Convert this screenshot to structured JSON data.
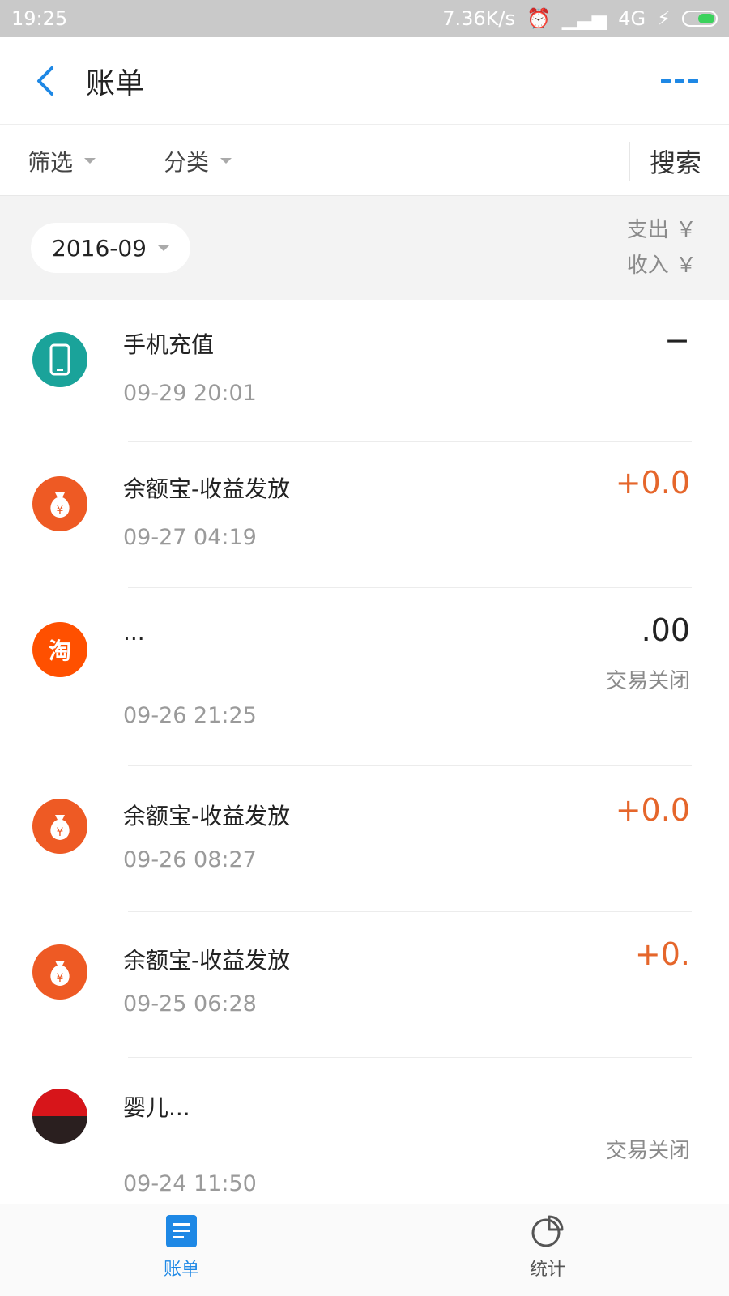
{
  "status_bar": {
    "time": "19:25",
    "network_speed": "7.36K/s",
    "network_type": "4G"
  },
  "header": {
    "title": "账单"
  },
  "filters": {
    "filter_label": "筛选",
    "category_label": "分类",
    "search_label": "搜索"
  },
  "summary": {
    "month": "2016-09",
    "expense": "支出 ￥",
    "income": "收入 ￥"
  },
  "transactions": [
    {
      "icon": "phone-icon",
      "title": "手机充值",
      "time": "09-29  20:01",
      "amount": "−",
      "status": ""
    },
    {
      "icon": "money-bag-icon",
      "title": "余额宝-收益发放",
      "time": "09-27  04:19",
      "amount": "+0.0",
      "status": ""
    },
    {
      "icon": "taobao-icon",
      "title": "...",
      "time": "09-26  21:25",
      "amount": ".00",
      "status": "交易关闭"
    },
    {
      "icon": "money-bag-icon",
      "title": "余额宝-收益发放",
      "time": "09-26  08:27",
      "amount": "+0.0",
      "status": ""
    },
    {
      "icon": "money-bag-icon",
      "title": "余额宝-收益发放",
      "time": "09-25  06:28",
      "amount": "+0.",
      "status": ""
    },
    {
      "icon": "tmall-icon",
      "title": "婴儿...",
      "time": "09-24  11:50",
      "amount": "",
      "status": "交易关闭"
    }
  ],
  "tabbar": {
    "bill_label": "账单",
    "stats_label": "统计"
  },
  "colors": {
    "accent": "#1e88e5",
    "income": "#e5662b",
    "money_bag": "#ee5a24",
    "phone": "#1aa39a"
  }
}
